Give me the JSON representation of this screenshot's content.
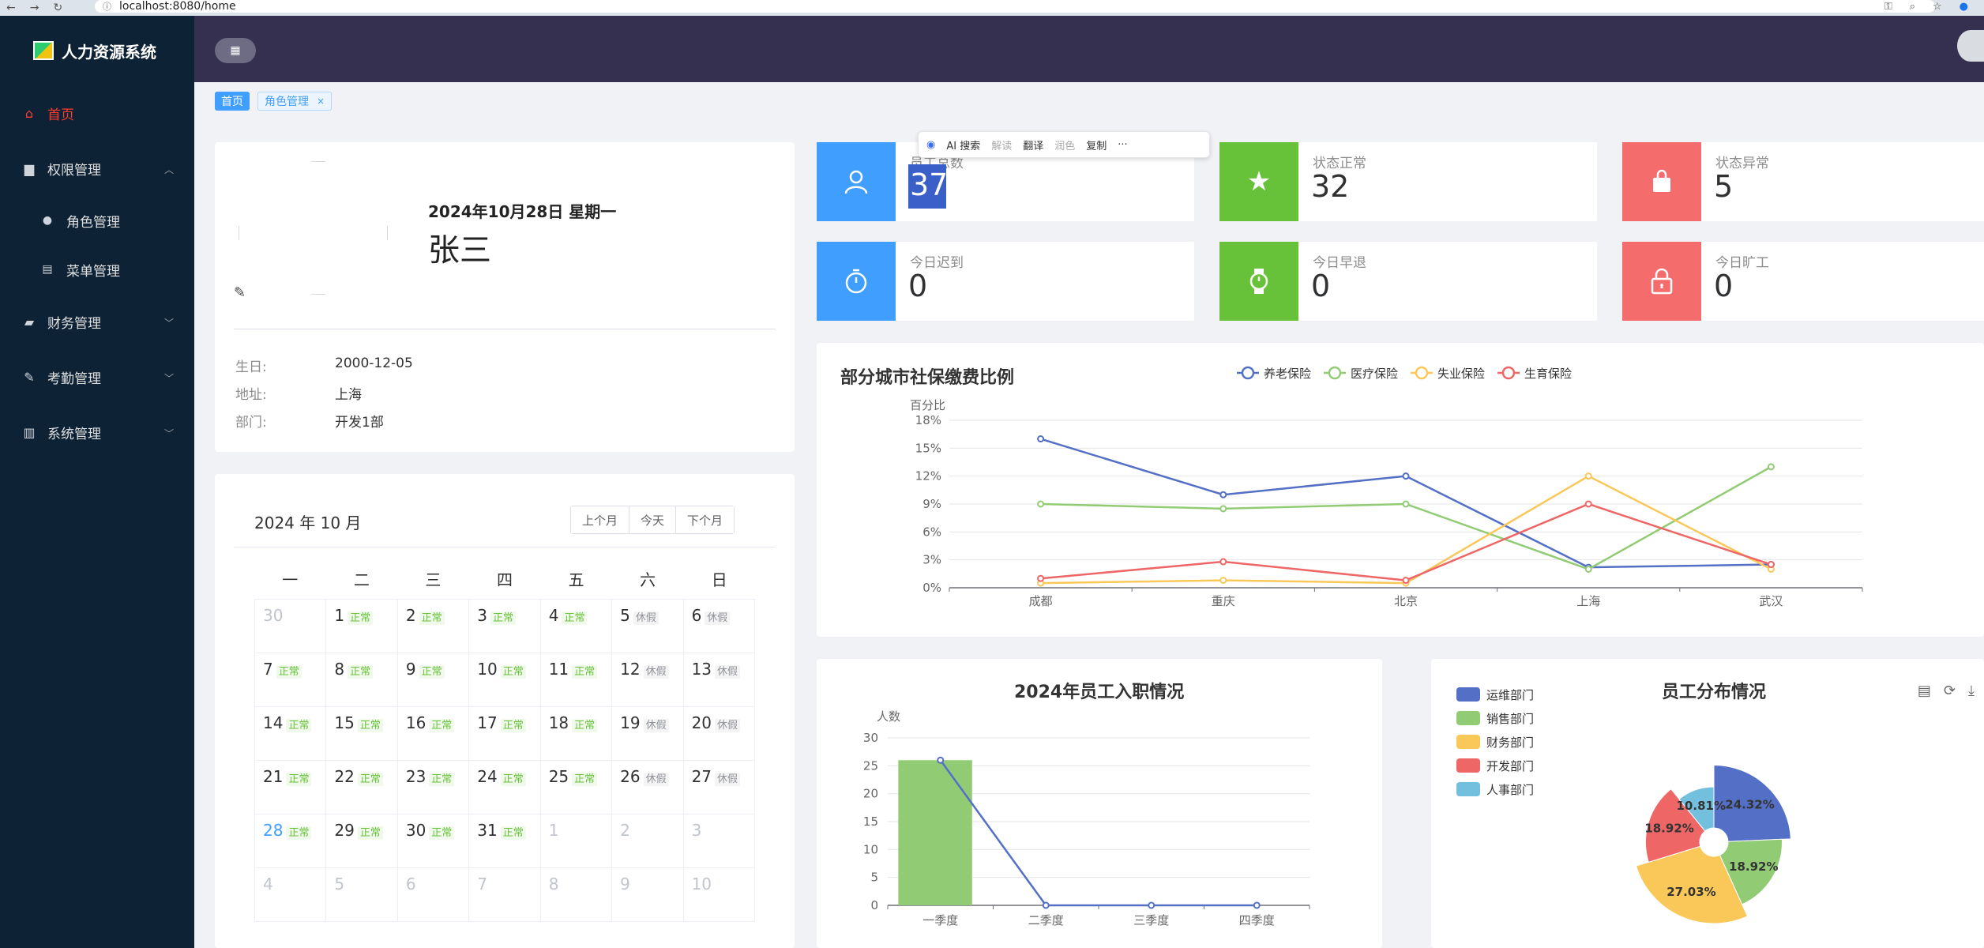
{
  "browser": {
    "url": "localhost:8080/home",
    "info_icon": "info-icon"
  },
  "app": {
    "title": "人力资源系统"
  },
  "sidebar": {
    "items": [
      {
        "label": "首页",
        "icon": "home-icon",
        "active": true
      },
      {
        "label": "权限管理",
        "icon": "briefcase-icon",
        "expanded": true,
        "children": [
          {
            "label": "角色管理",
            "icon": "user-icon"
          },
          {
            "label": "菜单管理",
            "icon": "book-icon"
          }
        ]
      },
      {
        "label": "财务管理",
        "icon": "wallet-icon"
      },
      {
        "label": "考勤管理",
        "icon": "pen-icon"
      },
      {
        "label": "系统管理",
        "icon": "bars-icon"
      }
    ]
  },
  "tags": [
    {
      "label": "首页",
      "active": true
    },
    {
      "label": "角色管理",
      "active": false,
      "close": "×"
    }
  ],
  "user": {
    "date": "2024年10月28日 星期一",
    "name": "张三",
    "rows": [
      {
        "label": "生日:",
        "value": "2000-12-05"
      },
      {
        "label": "地址:",
        "value": "上海"
      },
      {
        "label": "部门:",
        "value": "开发1部"
      }
    ]
  },
  "calendar": {
    "title": "2024 年 10 月",
    "buttons": [
      "上个月",
      "今天",
      "下个月"
    ],
    "weekdays": [
      "一",
      "二",
      "三",
      "四",
      "五",
      "六",
      "日"
    ],
    "days": [
      {
        "d": "30",
        "other": true
      },
      {
        "d": "1",
        "s": "正常"
      },
      {
        "d": "2",
        "s": "正常"
      },
      {
        "d": "3",
        "s": "正常"
      },
      {
        "d": "4",
        "s": "正常"
      },
      {
        "d": "5",
        "s": "休假"
      },
      {
        "d": "6",
        "s": "休假"
      },
      {
        "d": "7",
        "s": "正常"
      },
      {
        "d": "8",
        "s": "正常"
      },
      {
        "d": "9",
        "s": "正常"
      },
      {
        "d": "10",
        "s": "正常"
      },
      {
        "d": "11",
        "s": "正常"
      },
      {
        "d": "12",
        "s": "休假"
      },
      {
        "d": "13",
        "s": "休假"
      },
      {
        "d": "14",
        "s": "正常"
      },
      {
        "d": "15",
        "s": "正常"
      },
      {
        "d": "16",
        "s": "正常"
      },
      {
        "d": "17",
        "s": "正常"
      },
      {
        "d": "18",
        "s": "正常"
      },
      {
        "d": "19",
        "s": "休假"
      },
      {
        "d": "20",
        "s": "休假"
      },
      {
        "d": "21",
        "s": "正常"
      },
      {
        "d": "22",
        "s": "正常"
      },
      {
        "d": "23",
        "s": "正常"
      },
      {
        "d": "24",
        "s": "正常"
      },
      {
        "d": "25",
        "s": "正常"
      },
      {
        "d": "26",
        "s": "休假"
      },
      {
        "d": "27",
        "s": "休假"
      },
      {
        "d": "28",
        "s": "正常",
        "today": true
      },
      {
        "d": "29",
        "s": "正常"
      },
      {
        "d": "30",
        "s": "正常"
      },
      {
        "d": "31",
        "s": "正常"
      },
      {
        "d": "1",
        "other": true
      },
      {
        "d": "2",
        "other": true
      },
      {
        "d": "3",
        "other": true
      },
      {
        "d": "4",
        "other": true
      },
      {
        "d": "5",
        "other": true
      },
      {
        "d": "6",
        "other": true
      },
      {
        "d": "7",
        "other": true
      },
      {
        "d": "8",
        "other": true
      },
      {
        "d": "9",
        "other": true
      },
      {
        "d": "10",
        "other": true
      }
    ]
  },
  "stats": [
    {
      "label": "员工总数",
      "value": "37",
      "color": "blue",
      "icon": "user-icon"
    },
    {
      "label": "状态正常",
      "value": "32",
      "color": "green",
      "icon": "star-icon"
    },
    {
      "label": "状态异常",
      "value": "5",
      "color": "red",
      "icon": "bag-icon"
    },
    {
      "label": "今日迟到",
      "value": "0",
      "color": "blue",
      "icon": "stopwatch-icon"
    },
    {
      "label": "今日早退",
      "value": "0",
      "color": "green",
      "icon": "watch-icon"
    },
    {
      "label": "今日旷工",
      "value": "0",
      "color": "red",
      "icon": "lock-icon"
    }
  ],
  "selection_toolbar": {
    "items": [
      "AI 搜索",
      "解读",
      "翻译",
      "润色",
      "复制",
      "···"
    ]
  },
  "colors": {
    "blue": "#409eff",
    "green": "#67c23a",
    "red": "#f56c6c",
    "sidebar": "#0e2235",
    "header": "#35304f"
  },
  "chart_data": [
    {
      "type": "line",
      "title": "部分城市社保缴费比例",
      "ylabel": "百分比",
      "categories": [
        "成都",
        "重庆",
        "北京",
        "上海",
        "武汉"
      ],
      "ylim": [
        0,
        18
      ],
      "yticks": [
        "0%",
        "3%",
        "6%",
        "9%",
        "12%",
        "15%",
        "18%"
      ],
      "legend_position": "top",
      "series": [
        {
          "name": "养老保险",
          "color": "#5470c6",
          "values": [
            16,
            10,
            12,
            2.2,
            2.5
          ]
        },
        {
          "name": "医疗保险",
          "color": "#91cc75",
          "values": [
            9,
            8.5,
            9,
            2,
            13
          ]
        },
        {
          "name": "失业保险",
          "color": "#fac858",
          "values": [
            0.5,
            0.8,
            0.5,
            12,
            2
          ]
        },
        {
          "name": "生育保险",
          "color": "#ee6666",
          "values": [
            1,
            2.8,
            0.8,
            9,
            2.5
          ]
        }
      ]
    },
    {
      "type": "bar",
      "title": "2024年员工入职情况",
      "ylabel": "人数",
      "categories": [
        "一季度",
        "二季度",
        "三季度",
        "四季度"
      ],
      "ylim": [
        0,
        30
      ],
      "yticks": [
        "0",
        "5",
        "10",
        "15",
        "20",
        "25",
        "30"
      ],
      "bar_values": [
        26,
        0,
        0,
        0
      ],
      "line_values": [
        26,
        0,
        0,
        0
      ],
      "bar_color": "#91cc75",
      "line_color": "#5470c6"
    },
    {
      "type": "pie",
      "title": "员工分布情况",
      "legend_position": "left",
      "slices": [
        {
          "name": "运维部门",
          "label": "24.32%",
          "value": 24.32,
          "color": "#5470c6"
        },
        {
          "name": "销售部门",
          "label": "18.92%",
          "value": 18.92,
          "color": "#91cc75"
        },
        {
          "name": "财务部门",
          "label": "27.03%",
          "value": 27.03,
          "color": "#fac858"
        },
        {
          "name": "开发部门",
          "label": "18.92%",
          "value": 18.92,
          "color": "#ee6666"
        },
        {
          "name": "人事部门",
          "label": "10.81%",
          "value": 10.81,
          "color": "#73c0de"
        }
      ]
    }
  ]
}
